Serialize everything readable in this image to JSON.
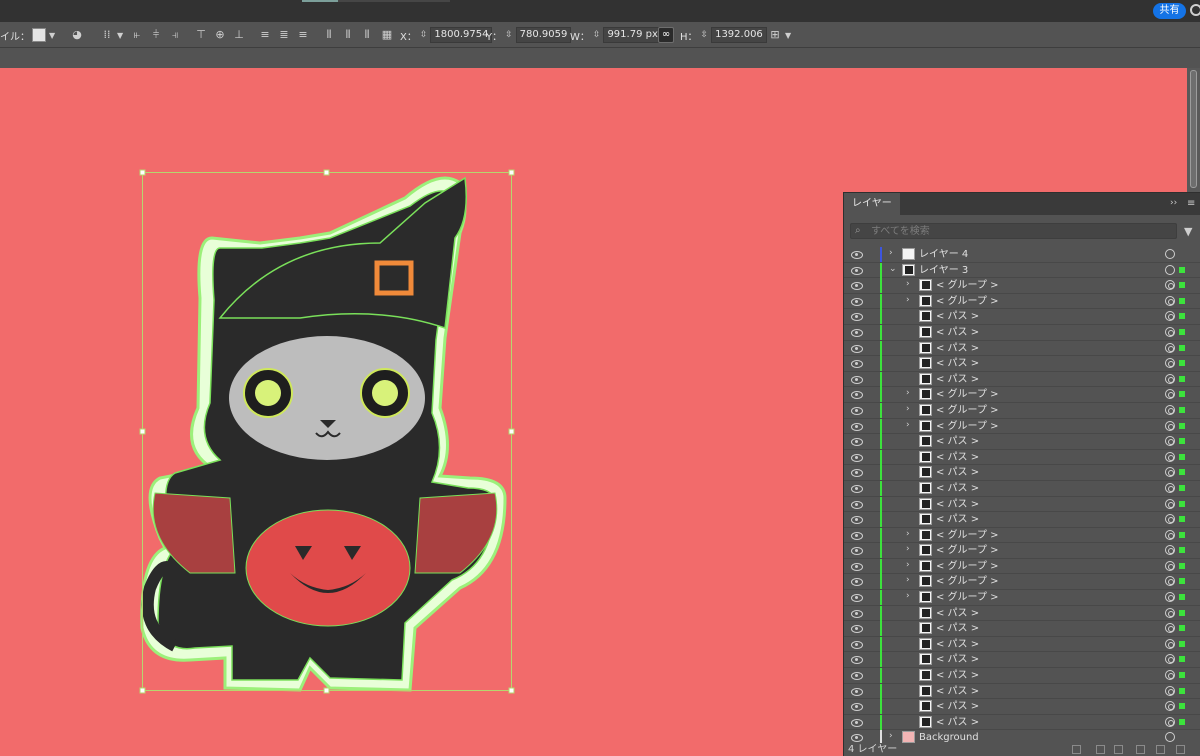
{
  "topbar": {
    "share_label": "共有"
  },
  "controlbar": {
    "style_label": "イル：",
    "x_label": "X：",
    "x_value": "1800.9754",
    "y_label": "Y：",
    "y_value": "780.9059",
    "w_label": "W：",
    "w_value": "991.79 px",
    "h_label": "H：",
    "h_value": "1392.006"
  },
  "layers_panel": {
    "tab_label": "レイヤー",
    "search_placeholder": "すべてを検索",
    "footer_count": "4 レイヤー",
    "rows": [
      {
        "name": "レイヤー 4",
        "indent": 0,
        "disclosure": "›",
        "bar": "#3d55e0",
        "sel": "empty",
        "target": "plain"
      },
      {
        "name": "レイヤー 3",
        "indent": 0,
        "disclosure": "⌄",
        "bar": "#3ce33c",
        "sel": "filled",
        "target": "plain"
      },
      {
        "name": "< グループ >",
        "indent": 1,
        "disclosure": "›",
        "bar": "#3ce33c",
        "sel": "filled",
        "target": "filled"
      },
      {
        "name": "< グループ >",
        "indent": 1,
        "disclosure": "›",
        "bar": "#3ce33c",
        "sel": "filled",
        "target": "filled"
      },
      {
        "name": "< パス >",
        "indent": 1,
        "disclosure": "",
        "bar": "#3ce33c",
        "sel": "filled",
        "target": "filled"
      },
      {
        "name": "< パス >",
        "indent": 1,
        "disclosure": "",
        "bar": "#3ce33c",
        "sel": "filled",
        "target": "filled"
      },
      {
        "name": "< パス >",
        "indent": 1,
        "disclosure": "",
        "bar": "#3ce33c",
        "sel": "filled",
        "target": "filled"
      },
      {
        "name": "< パス >",
        "indent": 1,
        "disclosure": "",
        "bar": "#3ce33c",
        "sel": "filled",
        "target": "filled"
      },
      {
        "name": "< パス >",
        "indent": 1,
        "disclosure": "",
        "bar": "#3ce33c",
        "sel": "filled",
        "target": "filled"
      },
      {
        "name": "< グループ >",
        "indent": 1,
        "disclosure": "›",
        "bar": "#3ce33c",
        "sel": "filled",
        "target": "filled"
      },
      {
        "name": "< グループ >",
        "indent": 1,
        "disclosure": "›",
        "bar": "#3ce33c",
        "sel": "filled",
        "target": "filled"
      },
      {
        "name": "< グループ >",
        "indent": 1,
        "disclosure": "›",
        "bar": "#3ce33c",
        "sel": "filled",
        "target": "filled"
      },
      {
        "name": "< パス >",
        "indent": 1,
        "disclosure": "",
        "bar": "#3ce33c",
        "sel": "filled",
        "target": "filled"
      },
      {
        "name": "< パス >",
        "indent": 1,
        "disclosure": "",
        "bar": "#3ce33c",
        "sel": "filled",
        "target": "filled"
      },
      {
        "name": "< パス >",
        "indent": 1,
        "disclosure": "",
        "bar": "#3ce33c",
        "sel": "filled",
        "target": "filled"
      },
      {
        "name": "< パス >",
        "indent": 1,
        "disclosure": "",
        "bar": "#3ce33c",
        "sel": "filled",
        "target": "filled"
      },
      {
        "name": "< パス >",
        "indent": 1,
        "disclosure": "",
        "bar": "#3ce33c",
        "sel": "filled",
        "target": "filled"
      },
      {
        "name": "< パス >",
        "indent": 1,
        "disclosure": "",
        "bar": "#3ce33c",
        "sel": "filled",
        "target": "filled"
      },
      {
        "name": "< グループ >",
        "indent": 1,
        "disclosure": "›",
        "bar": "#3ce33c",
        "sel": "filled",
        "target": "filled"
      },
      {
        "name": "< グループ >",
        "indent": 1,
        "disclosure": "›",
        "bar": "#3ce33c",
        "sel": "filled",
        "target": "filled"
      },
      {
        "name": "< グループ >",
        "indent": 1,
        "disclosure": "›",
        "bar": "#3ce33c",
        "sel": "filled",
        "target": "filled"
      },
      {
        "name": "< グループ >",
        "indent": 1,
        "disclosure": "›",
        "bar": "#3ce33c",
        "sel": "filled",
        "target": "filled"
      },
      {
        "name": "< グループ >",
        "indent": 1,
        "disclosure": "›",
        "bar": "#3ce33c",
        "sel": "filled",
        "target": "filled"
      },
      {
        "name": "< パス >",
        "indent": 1,
        "disclosure": "",
        "bar": "#3ce33c",
        "sel": "filled",
        "target": "filled"
      },
      {
        "name": "< パス >",
        "indent": 1,
        "disclosure": "",
        "bar": "#3ce33c",
        "sel": "filled",
        "target": "filled"
      },
      {
        "name": "< パス >",
        "indent": 1,
        "disclosure": "",
        "bar": "#3ce33c",
        "sel": "filled",
        "target": "filled"
      },
      {
        "name": "< パス >",
        "indent": 1,
        "disclosure": "",
        "bar": "#3ce33c",
        "sel": "filled",
        "target": "filled"
      },
      {
        "name": "< パス >",
        "indent": 1,
        "disclosure": "",
        "bar": "#3ce33c",
        "sel": "filled",
        "target": "filled"
      },
      {
        "name": "< パス >",
        "indent": 1,
        "disclosure": "",
        "bar": "#3ce33c",
        "sel": "filled",
        "target": "filled"
      },
      {
        "name": "< パス >",
        "indent": 1,
        "disclosure": "",
        "bar": "#3ce33c",
        "sel": "filled",
        "target": "filled"
      },
      {
        "name": "< パス >",
        "indent": 1,
        "disclosure": "",
        "bar": "#3ce33c",
        "sel": "filled",
        "target": "filled"
      },
      {
        "name": "Background",
        "indent": 0,
        "disclosure": "›",
        "bar": "#e0e0e0",
        "sel": "empty",
        "target": "plain",
        "thumb_color": "#f2b4b4"
      }
    ]
  },
  "colors": {
    "canvas": "#f26b6b",
    "selection": "#b6d66e",
    "accent": "#1473e6",
    "layer_green": "#3ce33c"
  }
}
